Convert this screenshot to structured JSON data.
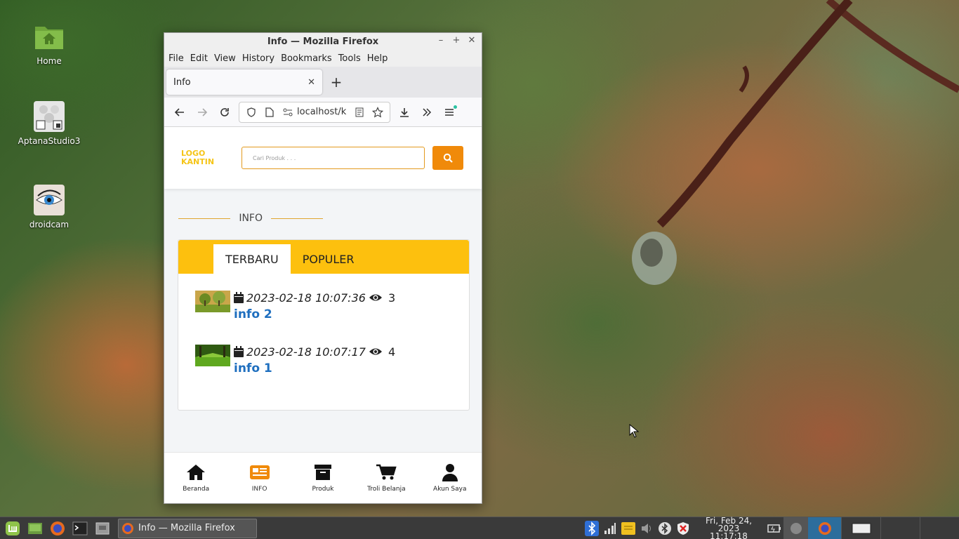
{
  "desktop": {
    "icons": [
      {
        "label": "Home"
      },
      {
        "label": "AptanaStudio3"
      },
      {
        "label": "droidcam"
      }
    ]
  },
  "window": {
    "title": "Info — Mozilla Firefox",
    "menu": [
      "File",
      "Edit",
      "View",
      "History",
      "Bookmarks",
      "Tools",
      "Help"
    ],
    "tab_title": "Info",
    "url": "localhost/k"
  },
  "site": {
    "logo_line1": "LOGO",
    "logo_line2": "KANTIN",
    "search_placeholder": "Cari Produk . . .",
    "section_title": "INFO",
    "tabs": [
      "TERBARU",
      "POPULER"
    ],
    "items": [
      {
        "date": "2023-02-18 10:07:36",
        "views": "3",
        "title": "info 2"
      },
      {
        "date": "2023-02-18 10:07:17",
        "views": "4",
        "title": "info 1"
      }
    ],
    "bottom_nav": [
      "Beranda",
      "INFO",
      "Produk",
      "Troli Belanja",
      "Akun Saya"
    ],
    "accent_color": "#fdc00e",
    "button_color": "#f08a0a",
    "link_color": "#1f6fbf"
  },
  "taskbar": {
    "task_label": "Info — Mozilla Firefox",
    "date": "Fri, Feb 24, 2023",
    "time": "11:17:18"
  }
}
